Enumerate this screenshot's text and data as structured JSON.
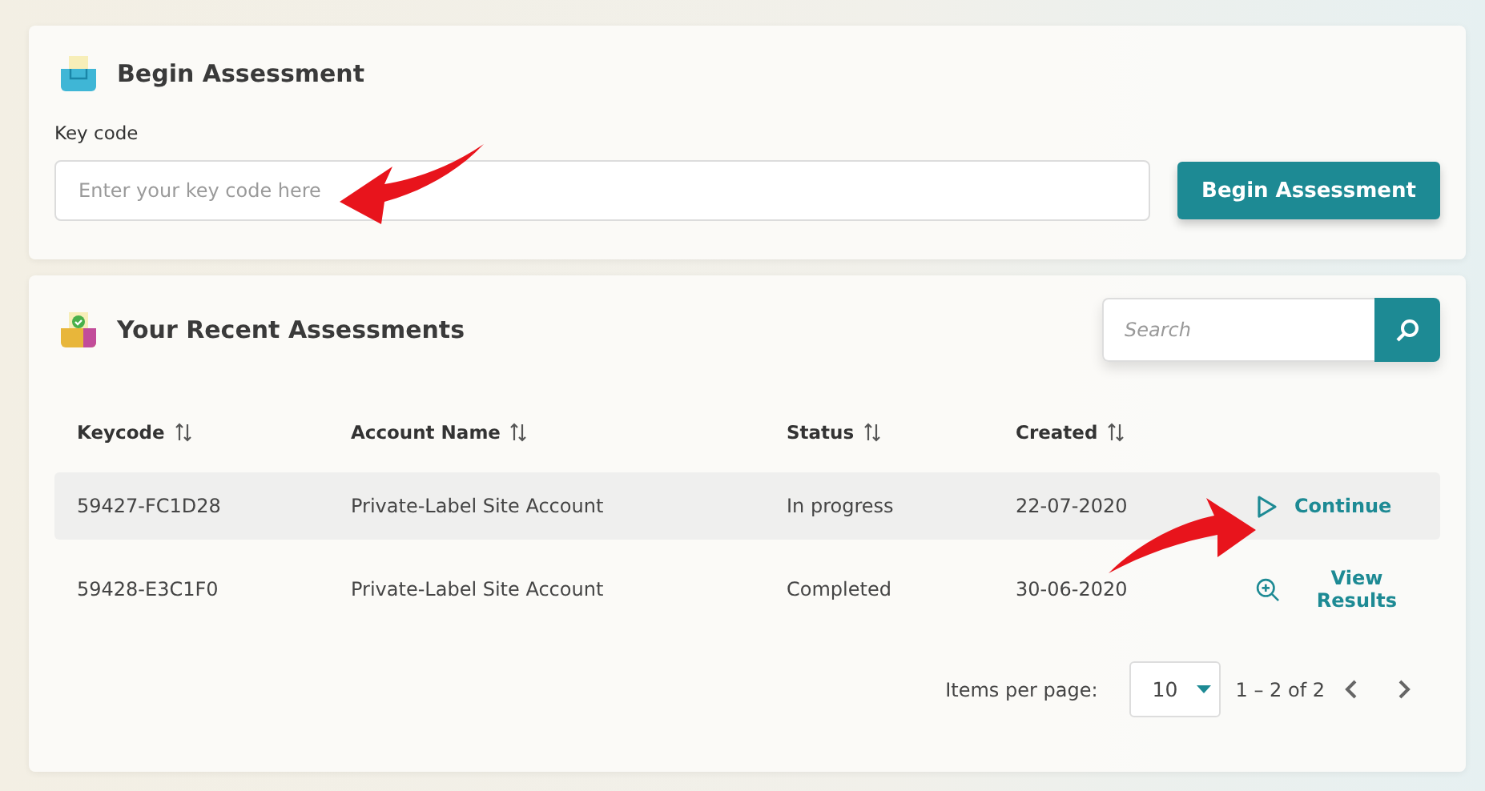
{
  "begin_card": {
    "title": "Begin Assessment",
    "key_label": "Key code",
    "key_placeholder": "Enter your key code here",
    "button": "Begin Assessment"
  },
  "recent_card": {
    "title": "Your Recent Assessments",
    "search": {
      "placeholder": "Search"
    },
    "table": {
      "columns": [
        "Keycode",
        "Account Name",
        "Status",
        "Created"
      ],
      "rows": [
        {
          "keycode": "59427-FC1D28",
          "account": "Private-Label Site Account",
          "status": "In progress",
          "created": "22-07-2020",
          "action": {
            "kind": "play",
            "label": "Continue"
          },
          "selected": true
        },
        {
          "keycode": "59428-E3C1F0",
          "account": "Private-Label Site Account",
          "status": "Completed",
          "created": "30-06-2020",
          "action": {
            "kind": "zoom",
            "label": "View Results"
          },
          "selected": false
        }
      ]
    },
    "pagination": {
      "label": "Items per page:",
      "page_size": "10",
      "range": "1 – 2 of 2"
    }
  }
}
